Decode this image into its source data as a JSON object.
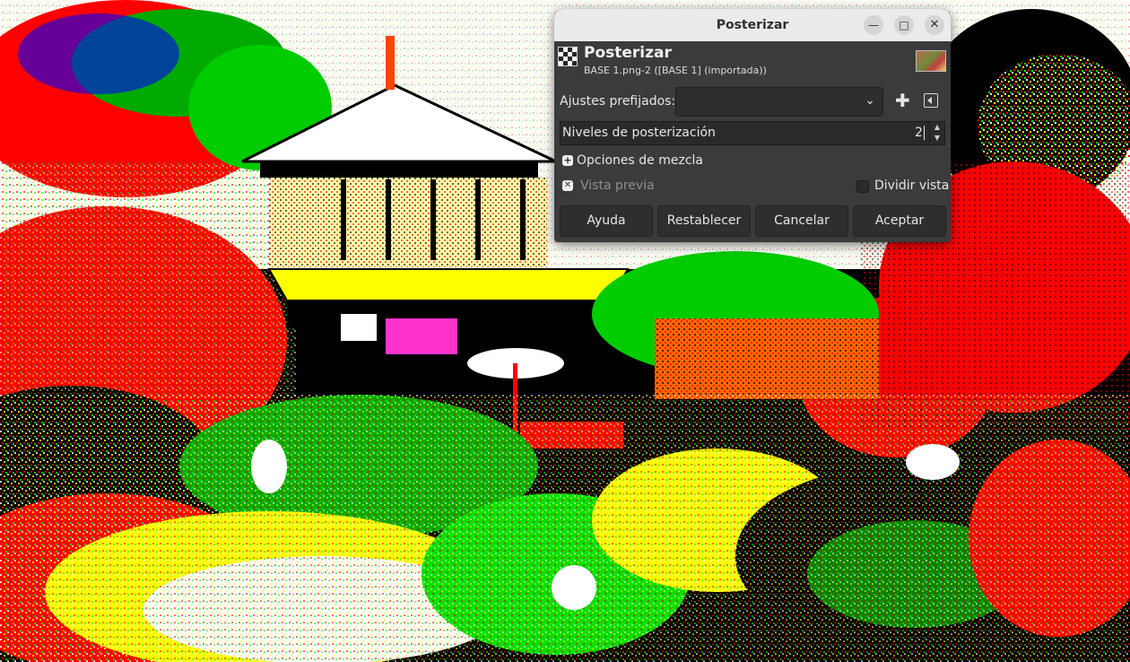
{
  "window": {
    "title": "Posterizar",
    "controls": [
      "minimize-icon",
      "maximize-icon",
      "close-icon"
    ]
  },
  "header": {
    "title": "Posterizar",
    "subtitle": "BASE 1.png-2 ([BASE 1] (importada))"
  },
  "presets": {
    "label": "Ajustes prefijados:",
    "value": ""
  },
  "levels": {
    "label": "Niveles de posterización",
    "value": "2"
  },
  "blend": {
    "label": "Opciones de mezcla",
    "expanded": false
  },
  "preview": {
    "label": "Vista previa",
    "checked": true
  },
  "split": {
    "label": "Dividir vista",
    "checked": false
  },
  "buttons": {
    "help": "Ayuda",
    "reset": "Restablecer",
    "cancel": "Cancelar",
    "ok": "Aceptar"
  },
  "colors": {
    "dialog_bg": "#3b3b3b",
    "titlebar_bg": "#ebebeb",
    "field_bg": "#2a2a2a"
  }
}
